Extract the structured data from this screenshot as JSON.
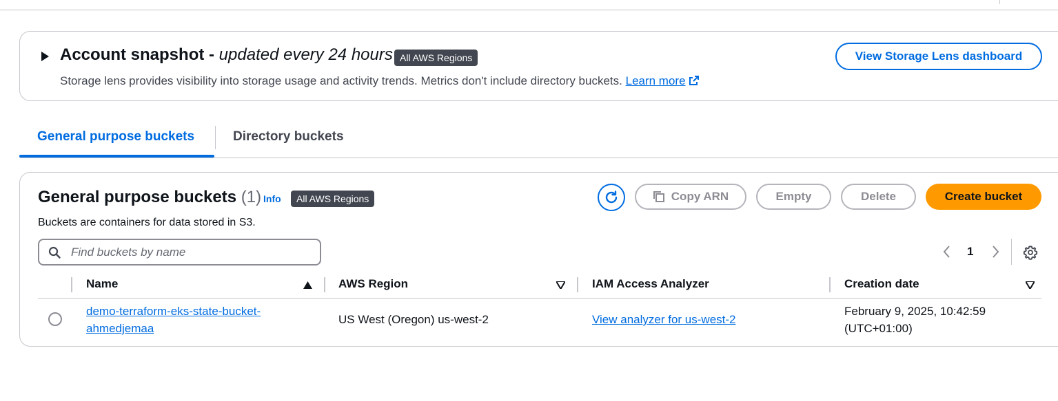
{
  "snapshot": {
    "title": "Account snapshot - ",
    "subtitle": "updated every 24 hours",
    "badge": "All AWS Regions",
    "description": "Storage lens provides visibility into storage usage and activity trends. Metrics don't include directory buckets.",
    "learn_more": "Learn more",
    "view_button": "View Storage Lens dashboard"
  },
  "tabs": [
    {
      "label": "General purpose buckets",
      "active": true
    },
    {
      "label": "Directory buckets",
      "active": false
    }
  ],
  "buckets_panel": {
    "title": "General purpose buckets",
    "count": "(1)",
    "info": "Info",
    "badge": "All AWS Regions",
    "description": "Buckets are containers for data stored in S3.",
    "buttons": {
      "copy_arn": "Copy ARN",
      "empty": "Empty",
      "delete": "Delete",
      "create": "Create bucket"
    },
    "search_placeholder": "Find buckets by name",
    "page": "1"
  },
  "table": {
    "columns": [
      "Name",
      "AWS Region",
      "IAM Access Analyzer",
      "Creation date"
    ],
    "rows": [
      {
        "name": "demo-terraform-eks-state-bucket-ahmedjemaa",
        "region": "US West (Oregon) us-west-2",
        "iam": "View analyzer for us-west-2",
        "created": "February 9, 2025, 10:42:59 (UTC+01:00)"
      }
    ]
  },
  "colors": {
    "accent": "#006ce0",
    "primary_button": "#ff9900",
    "badge_bg": "#424650",
    "border": "#c6c6cd"
  }
}
